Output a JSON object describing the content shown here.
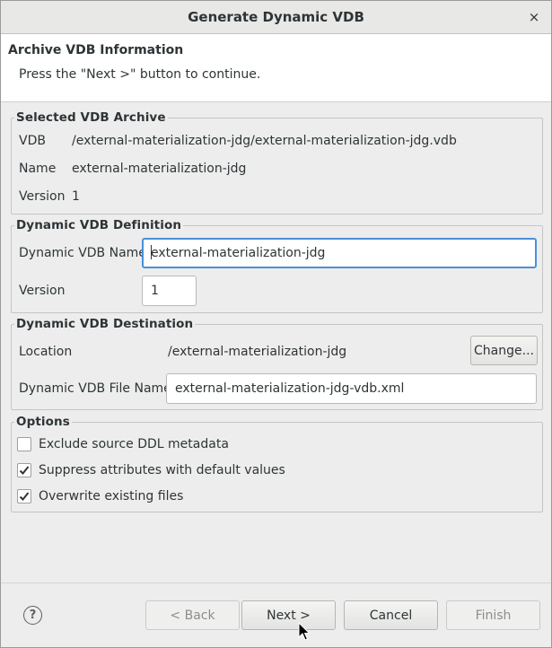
{
  "window": {
    "title": "Generate Dynamic VDB",
    "close_glyph": "×"
  },
  "header": {
    "title": "Archive VDB Information",
    "message": "Press the \"Next >\" button to continue."
  },
  "selected_archive": {
    "legend": "Selected VDB Archive",
    "vdb_label": "VDB",
    "vdb_value": "/external-materialization-jdg/external-materialization-jdg.vdb",
    "name_label": "Name",
    "name_value": "external-materialization-jdg",
    "version_label": "Version",
    "version_value": "1"
  },
  "definition": {
    "legend": "Dynamic VDB Definition",
    "name_label": "Dynamic VDB Name",
    "name_value": "external-materialization-jdg",
    "version_label": "Version",
    "version_value": "1"
  },
  "destination": {
    "legend": "Dynamic VDB Destination",
    "location_label": "Location",
    "location_value": "/external-materialization-jdg",
    "change_button": "Change...",
    "file_label": "Dynamic VDB File Name",
    "file_value": "external-materialization-jdg-vdb.xml"
  },
  "options": {
    "legend": "Options",
    "items": [
      {
        "label": "Exclude source DDL metadata",
        "checked": false
      },
      {
        "label": "Suppress attributes with default values",
        "checked": true
      },
      {
        "label": "Overwrite existing files",
        "checked": true
      }
    ]
  },
  "footer": {
    "help_glyph": "?",
    "back": "< Back",
    "next": "Next >",
    "cancel": "Cancel",
    "finish": "Finish"
  },
  "colors": {
    "focus": "#4a90d9",
    "window_bg": "#ededed"
  },
  "icons": {
    "help": "help-icon",
    "close": "close-icon",
    "check": "check-icon"
  }
}
